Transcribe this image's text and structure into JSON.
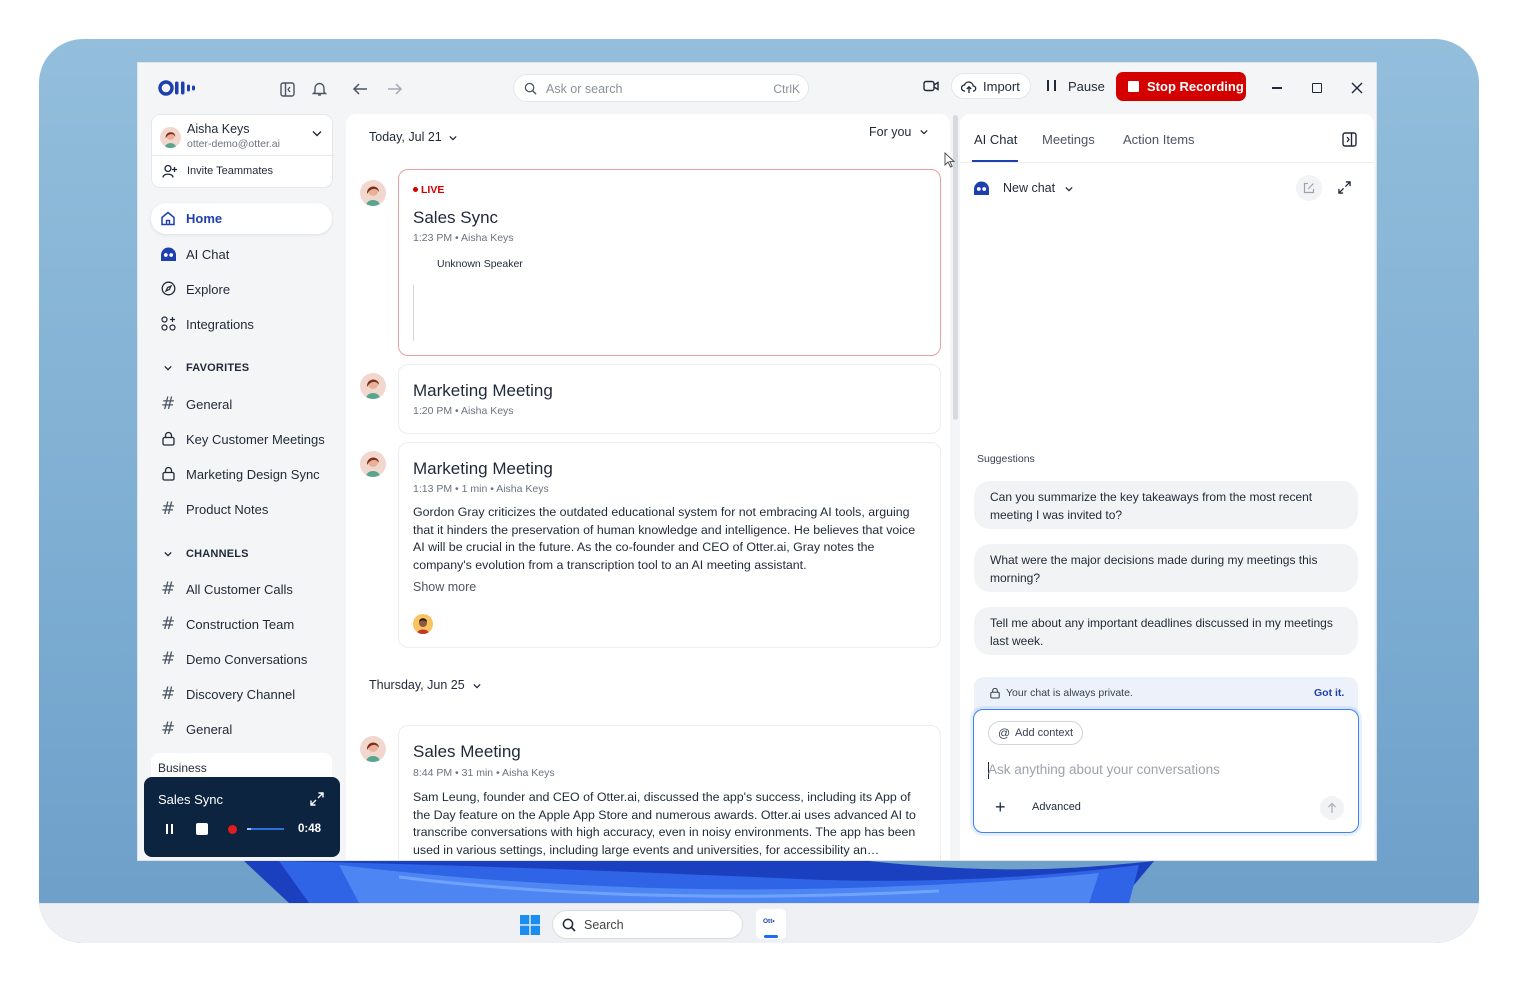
{
  "app": {
    "logo_text": "Ott•"
  },
  "topbar": {
    "search_placeholder": "Ask or search",
    "search_shortcut": "CtrlK",
    "import_label": "Import",
    "pause_label": "Pause",
    "stop_label": "Stop Recording"
  },
  "account": {
    "name": "Aisha Keys",
    "email": "otter-demo@otter.ai",
    "invite_label": "Invite Teammates"
  },
  "nav": {
    "home": "Home",
    "ai_chat": "AI Chat",
    "explore": "Explore",
    "integrations": "Integrations"
  },
  "favorites": {
    "title": "FAVORITES",
    "items": [
      "General",
      "Key Customer Meetings",
      "Marketing Design Sync",
      "Product Notes"
    ]
  },
  "channels": {
    "title": "CHANNELS",
    "items": [
      "All Customer Calls",
      "Construction Team",
      "Demo Conversations",
      "Discovery Channel",
      "General"
    ]
  },
  "workspace_label": "Business",
  "mini_player": {
    "title": "Sales Sync",
    "time": "0:48",
    "progress": 0.1
  },
  "feed": {
    "date1": "Today, Jul 21",
    "filter": "For you",
    "date2": "Thursday, Jun 25",
    "meetings": [
      {
        "live": "LIVE",
        "title": "Sales Sync",
        "meta": "1:23 PM • Aisha Keys",
        "speaker": "Unknown Speaker"
      },
      {
        "title": "Marketing Meeting",
        "meta": "1:20 PM • Aisha Keys"
      },
      {
        "title": "Marketing Meeting",
        "meta": "1:13 PM • 1 min • Aisha Keys",
        "summary": "Gordon Gray criticizes the outdated educational system for not embracing AI tools, arguing that it hinders the preservation of human knowledge and intelligence. He believes that voice AI will be crucial in the future. As the co-founder and CEO of Otter.ai, Gray notes the company's evolution from a transcription tool to an AI meeting assistant.",
        "show_more": "Show more"
      },
      {
        "title": "Sales Meeting",
        "meta": "8:44 PM • 31 min • Aisha Keys",
        "summary": "Sam Leung, founder and CEO of Otter.ai, discussed the app's success, including its App of the Day feature on the Apple App Store and numerous awards. Otter.ai uses advanced AI to transcribe conversations with high accuracy, even in noisy environments. The app has been used in various settings, including large events and universities, for accessibility an…"
      }
    ]
  },
  "right_panel": {
    "tabs": [
      "AI Chat",
      "Meetings",
      "Action Items"
    ],
    "new_chat": "New chat",
    "suggestions_title": "Suggestions",
    "suggestions": [
      "Can you summarize the key takeaways from the most recent meeting I was invited to?",
      "What were the major decisions made during my meetings this morning?",
      "Tell me about any important deadlines discussed in my meetings last week."
    ],
    "privacy_note": "Your chat is always private.",
    "got_it": "Got it.",
    "add_context": "Add context",
    "input_placeholder": "Ask anything about your conversations",
    "advanced": "Advanced"
  },
  "taskbar": {
    "search_label": "Search",
    "otter_icon_text": "Ott•"
  },
  "colors": {
    "accent": "#1e40af",
    "stop": "#d40000",
    "live": "#d40000",
    "player_bg": "#0c2440"
  }
}
